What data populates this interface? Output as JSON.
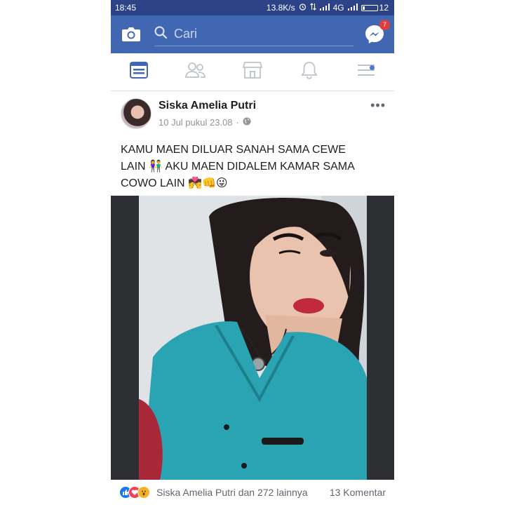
{
  "status_bar": {
    "time": "18:45",
    "network_speed": "13.8K/s",
    "network_type": "4G",
    "battery_level": "12"
  },
  "top_bar": {
    "search_placeholder": "Cari",
    "messenger_badge": "7",
    "brand_color": "#4267b2"
  },
  "tabs": [
    {
      "icon": "news-feed-icon",
      "active": true
    },
    {
      "icon": "friends-icon",
      "active": false
    },
    {
      "icon": "marketplace-icon",
      "active": false
    },
    {
      "icon": "notifications-bell-icon",
      "active": false
    },
    {
      "icon": "menu-icon",
      "active": false
    }
  ],
  "post": {
    "author": "Siska Amelia Putri",
    "timestamp": "10 Jul pukul 23.08",
    "separator": "·",
    "text_line1": "KAMU MAEN DILUAR SANAH SAMA CEWE",
    "text_line2_start": "LAIN",
    "text_line2_end": "AKU MAEN DIDALEM KAMAR SAMA",
    "text_line3": "COWO LAIN",
    "emoji_couple": "👫",
    "emoji_tail": "💏👊😜"
  },
  "footer": {
    "reactions": [
      "like-icon",
      "love-icon",
      "wow-icon"
    ],
    "likes_text": "Siska Amelia Putri dan 272 lainnya",
    "comments_text": "13 Komentar"
  }
}
